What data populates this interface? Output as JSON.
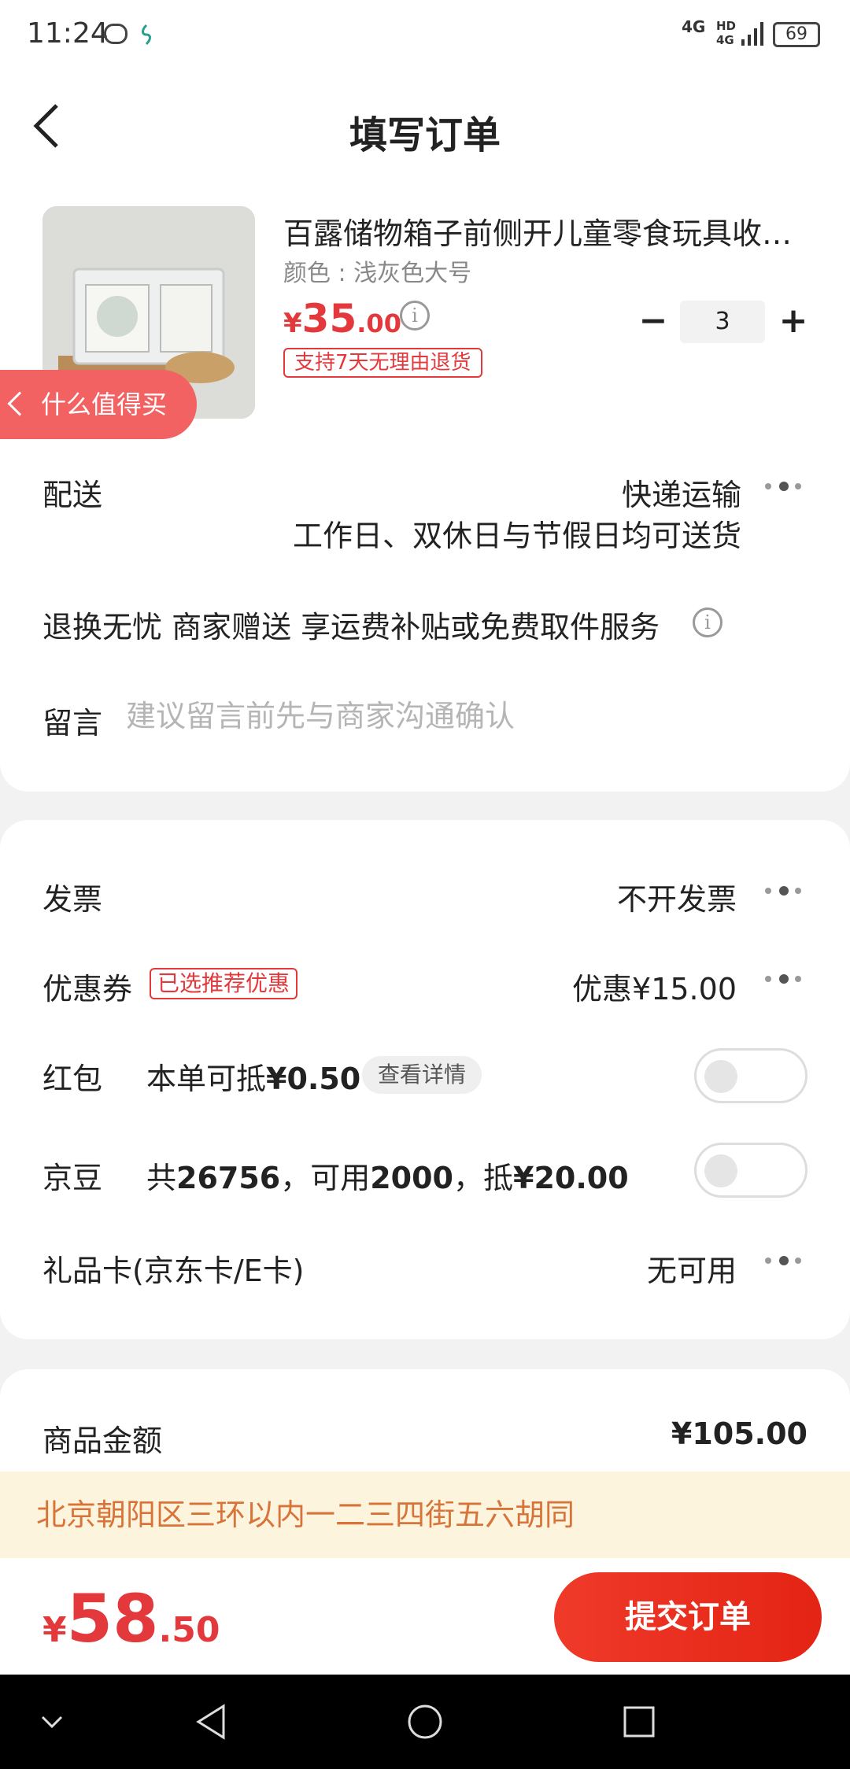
{
  "status_bar": {
    "time": "11:24",
    "network": "4G",
    "hd": "HD",
    "hd_network": "4G",
    "battery": "69"
  },
  "header": {
    "title": "填写订单"
  },
  "product": {
    "title": "百露储物箱子前侧开儿童零食玩具收纳箱",
    "spec": "颜色 : 浅灰色大号",
    "price_symbol": "¥",
    "price_int": "35",
    "price_dec": ".00",
    "return_tag": "支持7天无理由退货",
    "quantity": "3",
    "minus": "−",
    "plus": "+"
  },
  "delivery": {
    "label": "配送",
    "method": "快递运输",
    "note": "工作日、双休日与节假日均可送货"
  },
  "floating_tag": {
    "label": "什么值得买"
  },
  "service": {
    "text": "退换无忧 商家赠送  享运费补贴或免费取件服务"
  },
  "message": {
    "label": "留言",
    "placeholder": "建议留言前先与商家沟通确认"
  },
  "invoice": {
    "label": "发票",
    "value": "不开发票"
  },
  "coupon": {
    "label": "优惠券",
    "tag": "已选推荐优惠",
    "value": "优惠¥15.00"
  },
  "red_packet": {
    "label": "红包",
    "text_prefix": "本单可抵",
    "amount": "¥0.50",
    "detail": "查看详情",
    "enabled": false
  },
  "jd_beans": {
    "label": "京豆",
    "text_prefix": "共",
    "total": "26756",
    "sep1": "，可用",
    "usable": "2000",
    "sep2": "，抵",
    "deduct": "¥20.00",
    "enabled": false
  },
  "gift_card": {
    "label": "礼品卡(京东卡/E卡)",
    "value": "无可用"
  },
  "goods_amount": {
    "label": "商品金额",
    "value": "¥105.00"
  },
  "address": {
    "text": "北京朝阳区三环以内一二三四街五六胡同"
  },
  "total": {
    "symbol": "¥",
    "int": "58",
    "dec": ".50"
  },
  "submit": {
    "label": "提交订单"
  },
  "colors": {
    "accent": "#e4393c",
    "address_bg": "#fcf4dd",
    "address_text": "#d8743a"
  }
}
